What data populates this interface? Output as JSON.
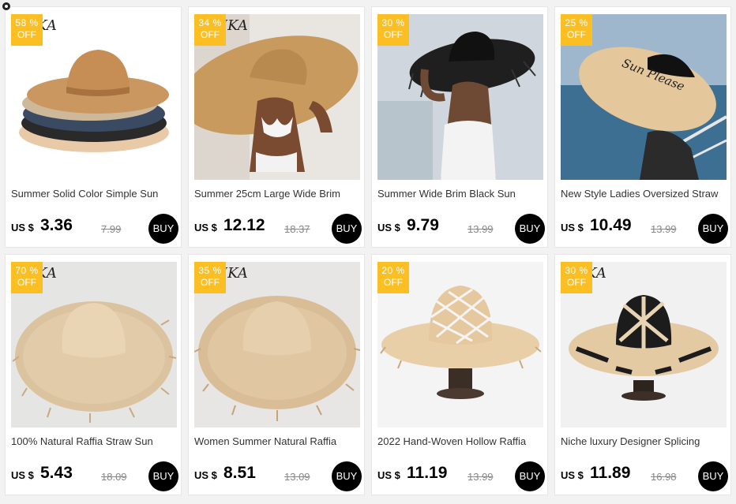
{
  "products": [
    {
      "discount": "58 %",
      "off_label": "OFF",
      "title": "Summer Solid Color Simple Sun",
      "currency": "US $",
      "price": "3.36",
      "old_price": "7.99",
      "buy_label": "BUY",
      "watermark": "IKA"
    },
    {
      "discount": "34 %",
      "off_label": "OFF",
      "title": "Summer 25cm Large Wide Brim",
      "currency": "US $",
      "price": "12.12",
      "old_price": "18.37",
      "buy_label": "BUY",
      "watermark": "IKA"
    },
    {
      "discount": "30 %",
      "off_label": "OFF",
      "title": "Summer Wide Brim Black Sun",
      "currency": "US $",
      "price": "9.79",
      "old_price": "13.99",
      "buy_label": "BUY",
      "watermark": ""
    },
    {
      "discount": "25 %",
      "off_label": "OFF",
      "title": "New Style Ladies Oversized Straw",
      "currency": "US $",
      "price": "10.49",
      "old_price": "13.99",
      "buy_label": "BUY",
      "watermark": "",
      "hat_text": "Sun Please"
    },
    {
      "discount": "70 %",
      "off_label": "OFF",
      "title": "100% Natural Raffia Straw Sun",
      "currency": "US $",
      "price": "5.43",
      "old_price": "18.09",
      "buy_label": "BUY",
      "watermark": "IKA"
    },
    {
      "discount": "35 %",
      "off_label": "OFF",
      "title": "Women Summer Natural Raffia",
      "currency": "US $",
      "price": "8.51",
      "old_price": "13.09",
      "buy_label": "BUY",
      "watermark": "IKA"
    },
    {
      "discount": "20 %",
      "off_label": "OFF",
      "title": "2022 Hand-Woven Hollow Raffia",
      "currency": "US $",
      "price": "11.19",
      "old_price": "13.99",
      "buy_label": "BUY",
      "watermark": ""
    },
    {
      "discount": "30 %",
      "off_label": "OFF",
      "title": "Niche luxury Designer Splicing",
      "currency": "US $",
      "price": "11.89",
      "old_price": "16.98",
      "buy_label": "BUY",
      "watermark": "IKA"
    }
  ],
  "colors": {
    "badge": "#fbbf24",
    "buy_button": "#000000",
    "page_bg": "#f2f2f2"
  }
}
